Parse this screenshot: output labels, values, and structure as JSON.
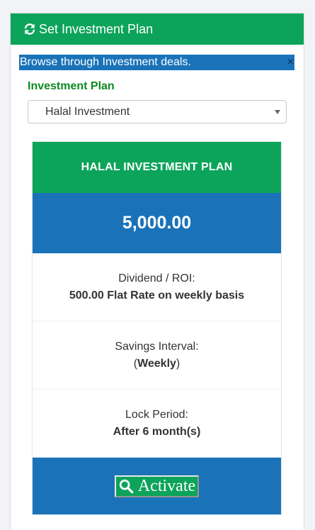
{
  "header": {
    "icon": "refresh-icon",
    "title": "Set Investment Plan"
  },
  "alert": {
    "message": "Browse through Investment deals.",
    "close_label": "×"
  },
  "form": {
    "label": "Investment Plan",
    "selected": "Halal Investment"
  },
  "plan": {
    "title": "HALAL INVESTMENT PLAN",
    "amount": "5,000.00",
    "dividend_label": "Dividend / ROI:",
    "dividend_value": "500.00 Flat Rate on weekly basis",
    "interval_label": "Savings Interval:",
    "interval_open": "(",
    "interval_value": "Weekly",
    "interval_close": ")",
    "lock_label": "Lock Period:",
    "lock_value": "After 6 month(s)",
    "activate_icon": "search-icon",
    "activate_label": "Activate"
  },
  "colors": {
    "green": "#0ca45a",
    "blue": "#1a73b9",
    "label_green": "#0b8a1e"
  }
}
